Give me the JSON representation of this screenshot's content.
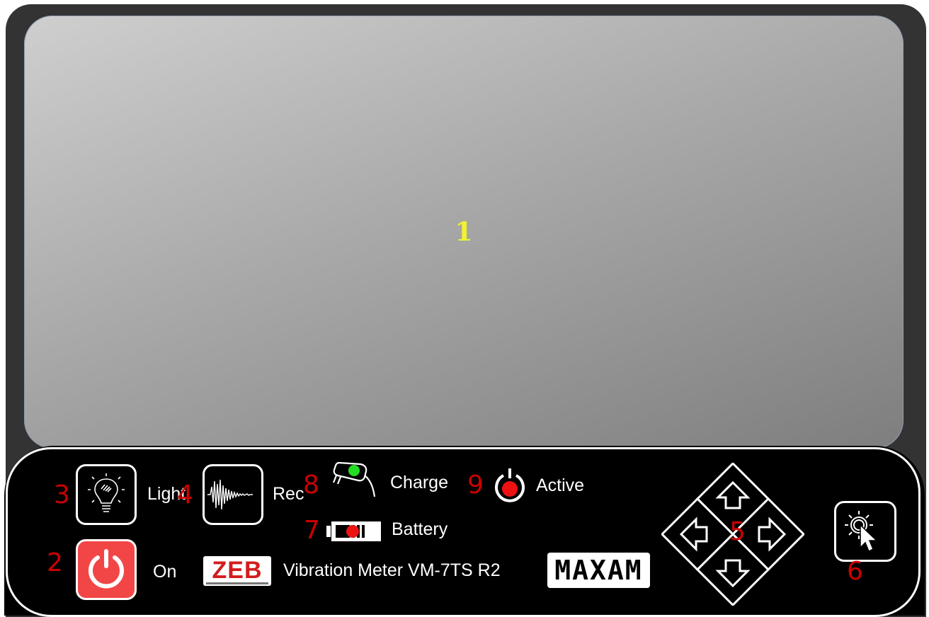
{
  "markers": {
    "screen": "1",
    "power": "2",
    "light": "3",
    "record": "4",
    "nav": "5",
    "select": "6",
    "battery": "7",
    "charge": "8",
    "active": "9"
  },
  "controls": {
    "light_label": "Light",
    "record_label": "Rec",
    "power_label": "On",
    "charge_label": "Charge",
    "active_label": "Active",
    "battery_label": "Battery"
  },
  "branding": {
    "zeb_logo": "ZEB",
    "product_name": "Vibration Meter VM-7TS R2",
    "maxam_logo": "MAXAM"
  },
  "icons": {
    "light": "light-bulb-icon",
    "record": "waveform-icon",
    "power": "power-icon",
    "charge": "charger-plug-icon",
    "active": "power-indicator-icon",
    "battery": "battery-icon",
    "nav_up": "arrow-up-icon",
    "nav_down": "arrow-down-icon",
    "nav_left": "arrow-left-icon",
    "nav_right": "arrow-right-icon",
    "select": "cursor-click-icon"
  },
  "colors": {
    "marker_red": "#cc0000",
    "screen_marker": "#f2f232",
    "power_button": "#f24646",
    "charge_led": "#22dd22",
    "active_led": "#ee1111",
    "battery_led": "#ee1111"
  }
}
